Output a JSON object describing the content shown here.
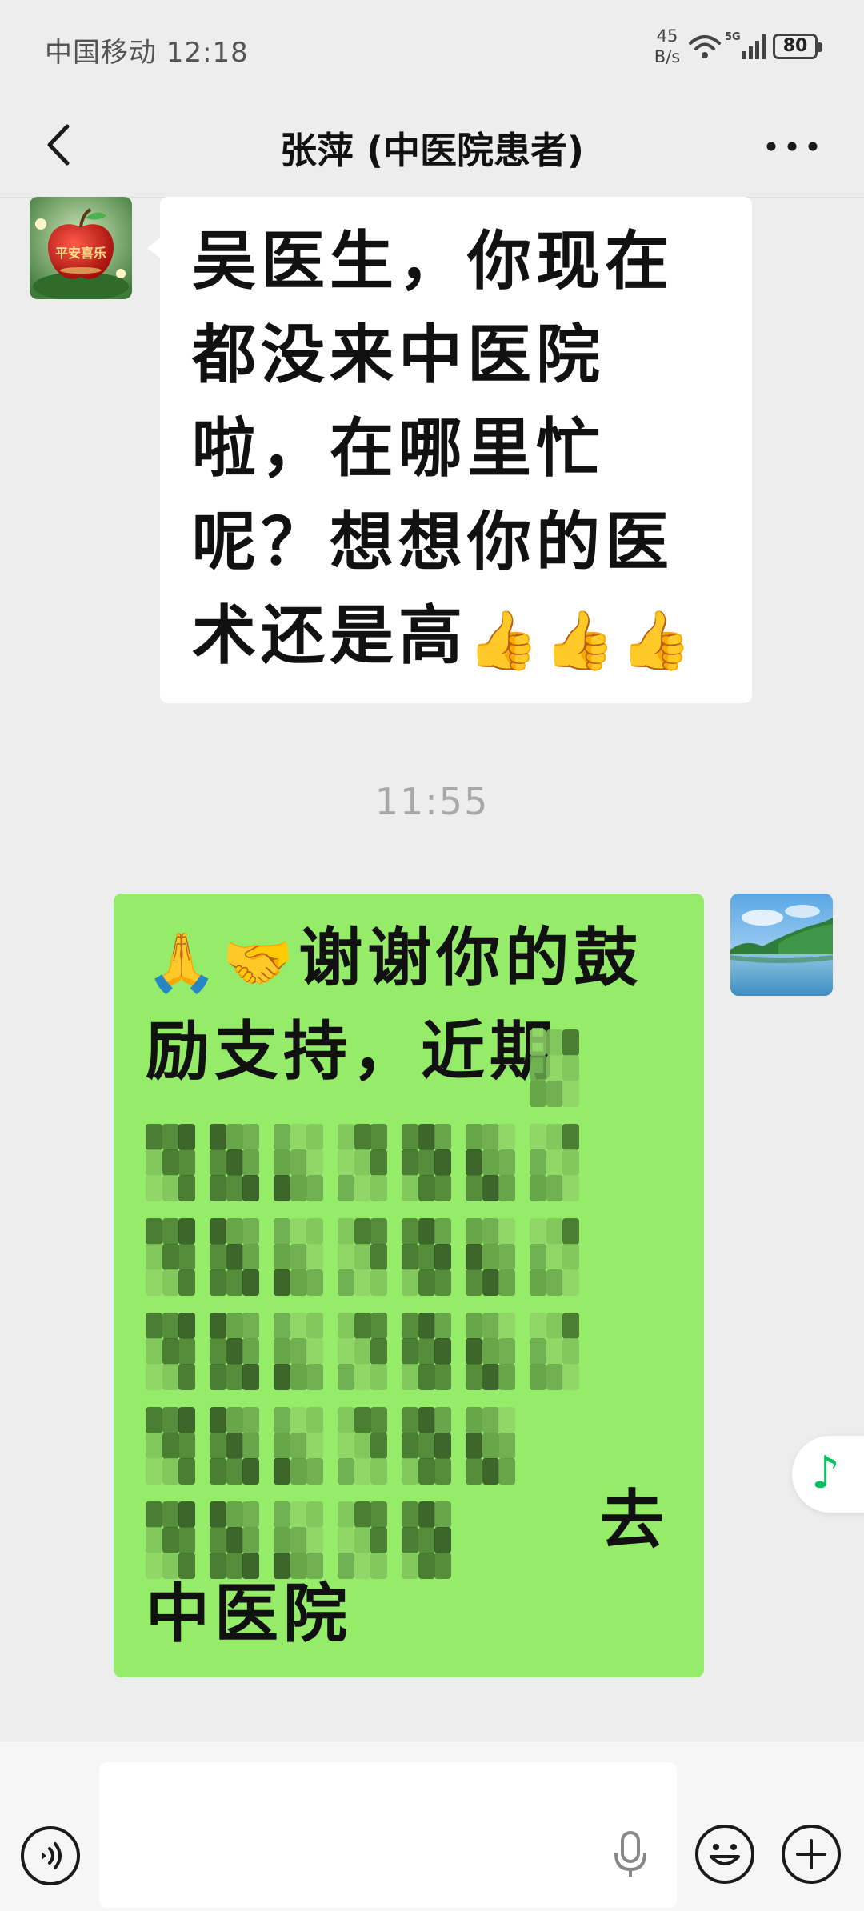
{
  "status_bar": {
    "carrier_time": "中国移动 12:18",
    "net_speed_value": "45",
    "net_speed_unit": "B/s",
    "network_type": "5G",
    "battery": "80"
  },
  "header": {
    "title": "张萍 (中医院患者)"
  },
  "messages": [
    {
      "direction": "incoming",
      "text": "吴医生，你现在都没来中医院啦，在哪里忙呢？想想你的医术还是高",
      "emoji": "👍👍👍"
    },
    {
      "timestamp": "11:55"
    },
    {
      "direction": "outgoing",
      "emoji_prefix": "🙏🤝",
      "text": "谢谢你的鼓励支持，近期",
      "text_end_1": "去",
      "text_end_2": "中医院",
      "obscured": true
    }
  ],
  "avatar_left_text": "平安喜乐",
  "colors": {
    "background": "#ededed",
    "incoming_bubble": "#ffffff",
    "outgoing_bubble": "#95ec69",
    "accent": "#07c160"
  },
  "input": {
    "placeholder": ""
  },
  "icons": {
    "back": "chevron-left-icon",
    "more": "more-dots-icon",
    "voice": "voice-icon",
    "mic": "microphone-icon",
    "emoji": "emoji-icon",
    "plus": "plus-icon",
    "music": "music-note-icon"
  }
}
